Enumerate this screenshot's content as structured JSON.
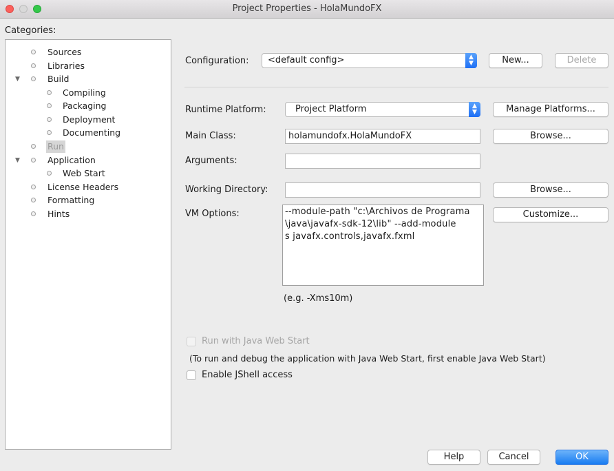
{
  "window": {
    "title": "Project Properties - HolaMundoFX"
  },
  "categories": {
    "label": "Categories:",
    "items": [
      {
        "label": "Sources",
        "level": 0,
        "expander": ""
      },
      {
        "label": "Libraries",
        "level": 0,
        "expander": ""
      },
      {
        "label": "Build",
        "level": 0,
        "expander": "▼"
      },
      {
        "label": "Compiling",
        "level": 1,
        "expander": ""
      },
      {
        "label": "Packaging",
        "level": 1,
        "expander": ""
      },
      {
        "label": "Deployment",
        "level": 1,
        "expander": ""
      },
      {
        "label": "Documenting",
        "level": 1,
        "expander": ""
      },
      {
        "label": "Run",
        "level": 0,
        "expander": "",
        "selected": true
      },
      {
        "label": "Application",
        "level": 0,
        "expander": "▼"
      },
      {
        "label": "Web Start",
        "level": 1,
        "expander": ""
      },
      {
        "label": "License Headers",
        "level": 0,
        "expander": ""
      },
      {
        "label": "Formatting",
        "level": 0,
        "expander": ""
      },
      {
        "label": "Hints",
        "level": 0,
        "expander": ""
      }
    ]
  },
  "configuration": {
    "label": "Configuration:",
    "value": "<default config>",
    "new_label": "New...",
    "delete_label": "Delete"
  },
  "runtime_platform": {
    "label": "Runtime Platform:",
    "value": "Project Platform",
    "manage_label": "Manage Platforms..."
  },
  "main_class": {
    "label": "Main Class:",
    "value": "holamundofx.HolaMundoFX",
    "browse_label": "Browse..."
  },
  "arguments": {
    "label": "Arguments:",
    "value": ""
  },
  "working_directory": {
    "label": "Working Directory:",
    "value": "",
    "browse_label": "Browse..."
  },
  "vm_options": {
    "label": "VM Options:",
    "lines": [
      "--module-path \"c:\\Archivos de Programa",
      "\\java\\javafx-sdk-12\\lib\" --add-module",
      "s javafx.controls,javafx.fxml"
    ],
    "customize_label": "Customize...",
    "hint": "(e.g. -Xms10m)"
  },
  "web_start": {
    "checkbox_label": "Run with Java Web Start",
    "checked": false,
    "enabled": false,
    "note": "(To run and debug the application with Java Web Start, first enable Java Web Start)"
  },
  "jshell": {
    "checkbox_label": "Enable JShell access",
    "checked": false
  },
  "footer": {
    "help_label": "Help",
    "cancel_label": "Cancel",
    "ok_label": "OK"
  },
  "colors": {
    "accent": "#1e6ff5",
    "window_bg": "#ececec"
  }
}
